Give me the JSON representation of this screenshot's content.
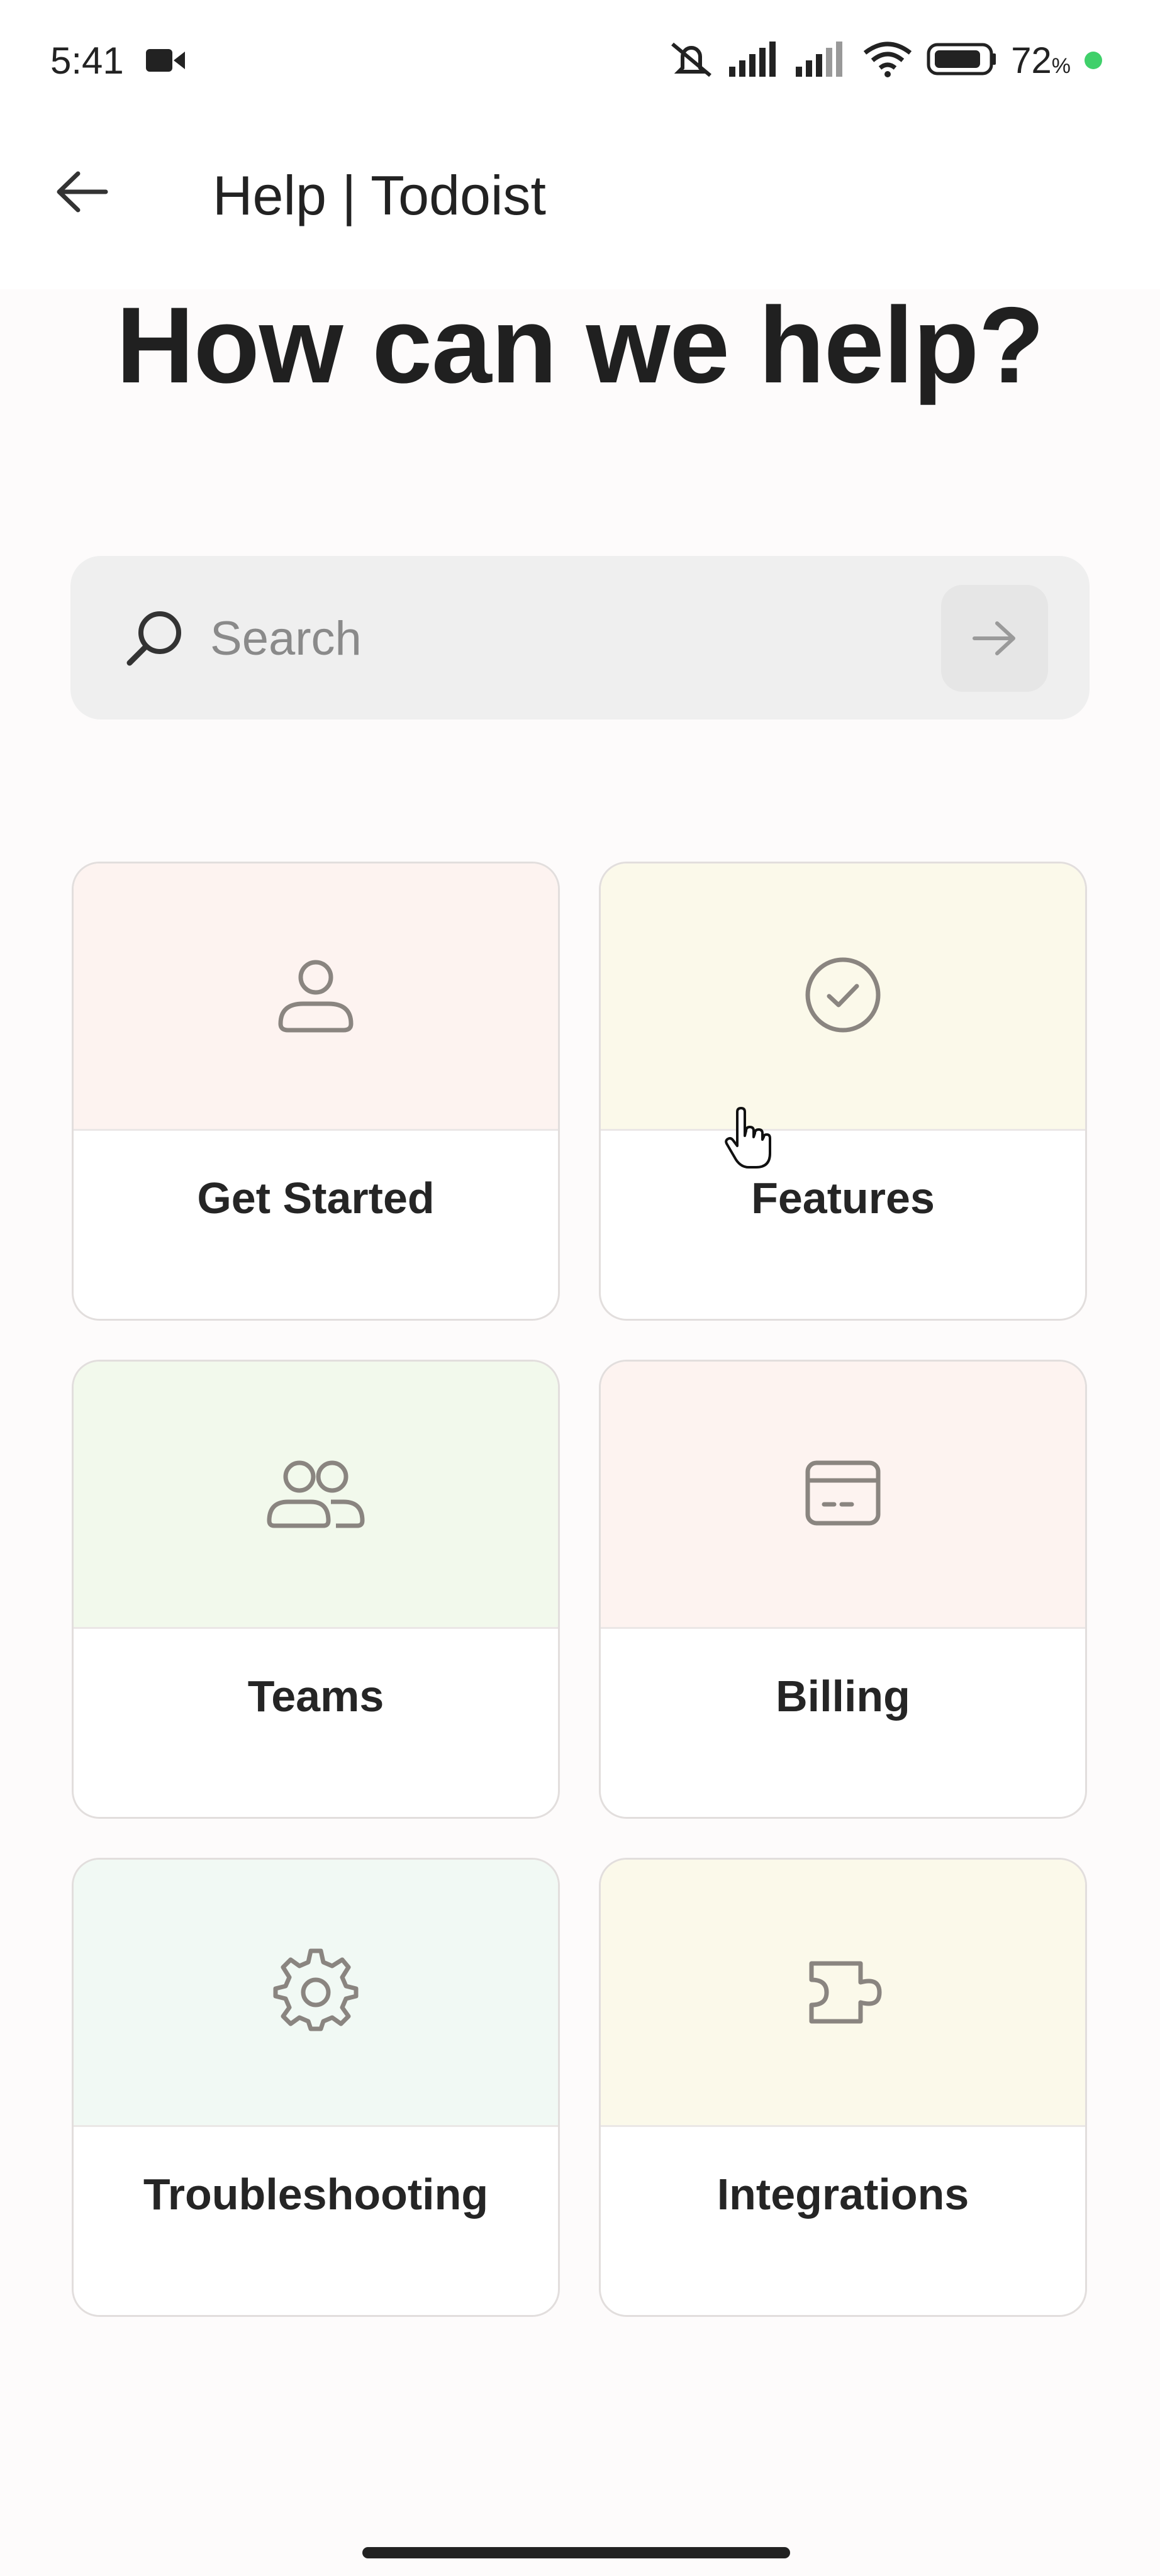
{
  "status_bar": {
    "time": "5:41",
    "battery_percent": "72",
    "battery_unit": "%"
  },
  "app_bar": {
    "title": "Help | Todoist"
  },
  "hero": {
    "title": "How can we help?"
  },
  "search": {
    "placeholder": "Search"
  },
  "categories": [
    {
      "label": "Get Started",
      "icon": "person-icon",
      "bg": "#fdf3f0"
    },
    {
      "label": "Features",
      "icon": "check-circle-icon",
      "bg": "#fbf9ea"
    },
    {
      "label": "Teams",
      "icon": "people-icon",
      "bg": "#f2f9ec"
    },
    {
      "label": "Billing",
      "icon": "credit-card-icon",
      "bg": "#fdf3f0"
    },
    {
      "label": "Troubleshooting",
      "icon": "gear-icon",
      "bg": "#f1f9f4"
    },
    {
      "label": "Integrations",
      "icon": "puzzle-icon",
      "bg": "#fbf9ea"
    }
  ],
  "colors": {
    "icon": "#8a8580",
    "card_border": "#e2dedd"
  }
}
